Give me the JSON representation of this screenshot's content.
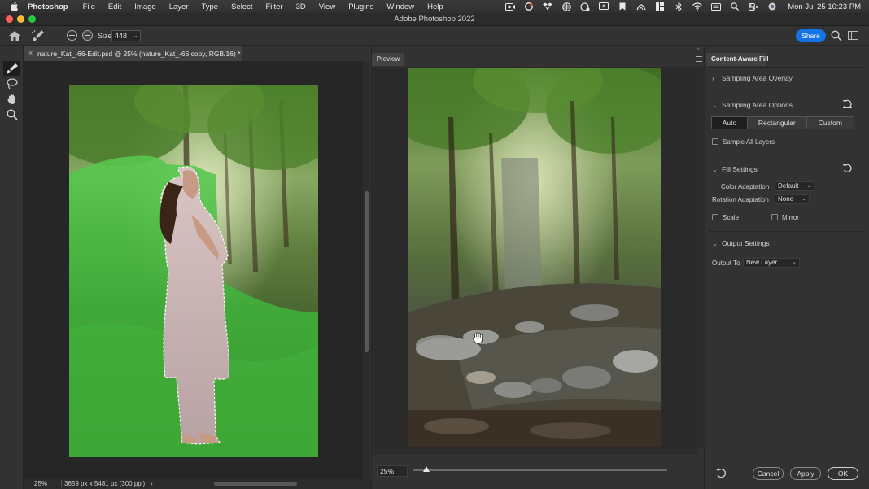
{
  "menubar": {
    "app_name": "Photoshop",
    "items": [
      "File",
      "Edit",
      "Image",
      "Layer",
      "Type",
      "Select",
      "Filter",
      "3D",
      "View",
      "Plugins",
      "Window",
      "Help"
    ],
    "clock": "Mon Jul 25  10:23 PM"
  },
  "window": {
    "title": "Adobe Photoshop 2022"
  },
  "options_bar": {
    "size_label": "Size",
    "size_value": "448",
    "share_label": "Share"
  },
  "document": {
    "tab_close": "×",
    "tab_title": "nature_Kat_-66-Edit.psd @ 25% (nature_Kat_-66 copy, RGB/16) *",
    "zoom": "25%",
    "dimensions": "3659 px x 5481 px (300 ppi)",
    "status_arrow": "›"
  },
  "preview": {
    "tab_label": "Preview",
    "zoom_value": "25%",
    "zoom_slider_fraction": 0.04
  },
  "caf": {
    "title": "Content-Aware Fill",
    "sampling_overlay": "Sampling Area Overlay",
    "sampling_options": "Sampling Area Options",
    "segments": [
      "Auto",
      "Rectangular",
      "Custom"
    ],
    "sample_all_layers": "Sample All Layers",
    "fill_settings": "Fill Settings",
    "color_adaptation_label": "Color Adaptation",
    "color_adaptation_value": "Default",
    "rotation_adaptation_label": "Rotation Adaptation",
    "rotation_adaptation_value": "None",
    "scale_label": "Scale",
    "mirror_label": "Mirror",
    "output_settings": "Output Settings",
    "output_to_label": "Output To",
    "output_to_value": "New Layer",
    "cancel": "Cancel",
    "apply": "Apply",
    "ok": "OK"
  },
  "colors": {
    "share_blue": "#1473e6",
    "overlay_green": "#3fc23f",
    "traffic_red": "#ff5f57",
    "traffic_yellow": "#febc2e",
    "traffic_green": "#28c840"
  }
}
